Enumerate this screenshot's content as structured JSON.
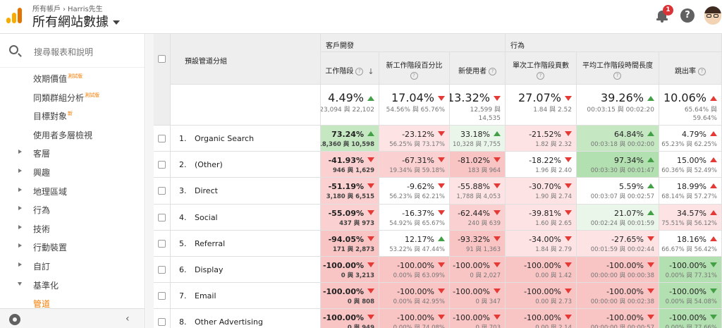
{
  "header": {
    "breadcrumb_account": "所有帳戶",
    "breadcrumb_property": "Harris先生",
    "view_title": "所有網站數據",
    "notification_count": "1",
    "help_icon": "?"
  },
  "sidebar": {
    "search_placeholder": "搜尋報表和說明",
    "items": [
      {
        "label": "效期價值",
        "tag": "測試版",
        "kind": "sub"
      },
      {
        "label": "同類群組分析",
        "tag": "測試版",
        "kind": "sub"
      },
      {
        "label": "目標對象",
        "tag": "新",
        "kind": "sub"
      },
      {
        "label": "使用者多層檢視",
        "tag": "",
        "kind": "sub"
      },
      {
        "label": "客層",
        "tag": "",
        "kind": "collapsed"
      },
      {
        "label": "興趣",
        "tag": "",
        "kind": "collapsed"
      },
      {
        "label": "地理區域",
        "tag": "",
        "kind": "collapsed"
      },
      {
        "label": "行為",
        "tag": "",
        "kind": "collapsed"
      },
      {
        "label": "技術",
        "tag": "",
        "kind": "collapsed"
      },
      {
        "label": "行動裝置",
        "tag": "",
        "kind": "collapsed"
      },
      {
        "label": "自訂",
        "tag": "",
        "kind": "collapsed"
      },
      {
        "label": "基準化",
        "tag": "",
        "kind": "expanded"
      },
      {
        "label": "管道",
        "tag": "",
        "kind": "active"
      }
    ],
    "collapse_glyph": "‹"
  },
  "table": {
    "dimension_header": "預設管道分組",
    "group_acquisition": "客戶開發",
    "group_behavior": "行為",
    "columns": [
      "工作階段",
      "新工作階段百分比",
      "新使用者",
      "單次工作階段頁數",
      "平均工作階段時間長度",
      "跳出率"
    ],
    "sort_glyph": "↓",
    "totals": [
      {
        "main": "4.49%",
        "dir": "up",
        "color": "g",
        "sub": [
          "23,094 與 22,102"
        ]
      },
      {
        "main": "17.04%",
        "dir": "dn",
        "color": "r",
        "sub": [
          "54.56% 與 65.76%"
        ]
      },
      {
        "main": "13.32%",
        "dir": "dn",
        "color": "r",
        "sub": [
          "12,599 與",
          "14,535"
        ]
      },
      {
        "main": "27.07%",
        "dir": "dn",
        "color": "r",
        "sub": [
          "1.84 與 2.52"
        ]
      },
      {
        "main": "39.26%",
        "dir": "up",
        "color": "g",
        "sub": [
          "00:03:15 與 00:02:20"
        ]
      },
      {
        "main": "10.06%",
        "dir": "up",
        "color": "r",
        "sub": [
          "65.64% 與",
          "59.64%"
        ]
      }
    ],
    "rows": [
      {
        "idx": "1.",
        "name": "Organic Search",
        "cells": [
          {
            "v": "73.24%",
            "d": "up",
            "c": "g",
            "s": "18,360 與 10,598",
            "bg": "#c5e8c3"
          },
          {
            "v": "-23.12%",
            "d": "dn",
            "c": "r",
            "s": "56.25% 與 73.17%",
            "bg": "#fde3e3"
          },
          {
            "v": "33.18%",
            "d": "up",
            "c": "g",
            "s": "10,328 與 7,755",
            "bg": "#eaf6e9"
          },
          {
            "v": "-21.52%",
            "d": "dn",
            "c": "r",
            "s": "1.82 與 2.32",
            "bg": "#fde3e3"
          },
          {
            "v": "64.84%",
            "d": "up",
            "c": "g",
            "s": "00:03:18 與 00:02:00",
            "bg": "#c5e8c3"
          },
          {
            "v": "4.79%",
            "d": "up",
            "c": "r",
            "s": "65.23% 與 62.25%",
            "bg": "#ffffff"
          }
        ]
      },
      {
        "idx": "2.",
        "name": "(Other)",
        "cells": [
          {
            "v": "-41.93%",
            "d": "dn",
            "c": "r",
            "s": "946 與 1,629",
            "bg": "#fbd0d0"
          },
          {
            "v": "-67.31%",
            "d": "dn",
            "c": "r",
            "s": "19.34% 與 59.18%",
            "bg": "#fbd0d0"
          },
          {
            "v": "-81.02%",
            "d": "dn",
            "c": "r",
            "s": "183 與 964",
            "bg": "#f9c4c4"
          },
          {
            "v": "-18.22%",
            "d": "dn",
            "c": "r",
            "s": "1.96 與 2.40",
            "bg": "#ffffff"
          },
          {
            "v": "97.34%",
            "d": "up",
            "c": "g",
            "s": "00:03:30 與 00:01:47",
            "bg": "#b3e0b0"
          },
          {
            "v": "15.00%",
            "d": "up",
            "c": "r",
            "s": "60.36% 與 52.49%",
            "bg": "#ffffff"
          }
        ]
      },
      {
        "idx": "3.",
        "name": "Direct",
        "cells": [
          {
            "v": "-51.19%",
            "d": "dn",
            "c": "r",
            "s": "3,180 與 6,515",
            "bg": "#fbd0d0"
          },
          {
            "v": "-9.62%",
            "d": "dn",
            "c": "r",
            "s": "56.23% 與 62.21%",
            "bg": "#ffffff"
          },
          {
            "v": "-55.88%",
            "d": "dn",
            "c": "r",
            "s": "1,788 與 4,053",
            "bg": "#fde3e3"
          },
          {
            "v": "-30.70%",
            "d": "dn",
            "c": "r",
            "s": "1.90 與 2.74",
            "bg": "#fde3e3"
          },
          {
            "v": "5.59%",
            "d": "up",
            "c": "g",
            "s": "00:03:07 與 00:02:57",
            "bg": "#ffffff"
          },
          {
            "v": "18.99%",
            "d": "up",
            "c": "r",
            "s": "68.14% 與 57.27%",
            "bg": "#ffffff"
          }
        ]
      },
      {
        "idx": "4.",
        "name": "Social",
        "cells": [
          {
            "v": "-55.09%",
            "d": "dn",
            "c": "r",
            "s": "437 與 973",
            "bg": "#fbd0d0"
          },
          {
            "v": "-16.37%",
            "d": "dn",
            "c": "r",
            "s": "54.92% 與 65.67%",
            "bg": "#ffffff"
          },
          {
            "v": "-62.44%",
            "d": "dn",
            "c": "r",
            "s": "240 與 639",
            "bg": "#fbd0d0"
          },
          {
            "v": "-39.81%",
            "d": "dn",
            "c": "r",
            "s": "1.60 與 2.65",
            "bg": "#fde3e3"
          },
          {
            "v": "21.07%",
            "d": "up",
            "c": "g",
            "s": "00:02:24 與 00:01:59",
            "bg": "#eaf6e9"
          },
          {
            "v": "34.57%",
            "d": "up",
            "c": "r",
            "s": "75.51% 與 56.12%",
            "bg": "#fde3e3"
          }
        ]
      },
      {
        "idx": "5.",
        "name": "Referral",
        "cells": [
          {
            "v": "-94.05%",
            "d": "dn",
            "c": "r",
            "s": "171 與 2,873",
            "bg": "#f9c4c4"
          },
          {
            "v": "12.17%",
            "d": "up",
            "c": "g",
            "s": "53.22% 與 47.44%",
            "bg": "#ffffff"
          },
          {
            "v": "-93.32%",
            "d": "dn",
            "c": "r",
            "s": "91 與 1,363",
            "bg": "#f9c4c4"
          },
          {
            "v": "-34.00%",
            "d": "dn",
            "c": "r",
            "s": "1.84 與 2.79",
            "bg": "#fde3e3"
          },
          {
            "v": "-27.65%",
            "d": "dn",
            "c": "r",
            "s": "00:01:59 與 00:02:44",
            "bg": "#fde3e3"
          },
          {
            "v": "18.16%",
            "d": "up",
            "c": "r",
            "s": "66.67% 與 56.42%",
            "bg": "#ffffff"
          }
        ]
      },
      {
        "idx": "6.",
        "name": "Display",
        "cells": [
          {
            "v": "-100.00%",
            "d": "dn",
            "c": "r",
            "s": "0 與 3,213",
            "bg": "#f9c4c4"
          },
          {
            "v": "-100.00%",
            "d": "dn",
            "c": "r",
            "s": "0.00% 與 63.09%",
            "bg": "#f9c4c4"
          },
          {
            "v": "-100.00%",
            "d": "dn",
            "c": "r",
            "s": "0 與 2,027",
            "bg": "#f9c4c4"
          },
          {
            "v": "-100.00%",
            "d": "dn",
            "c": "r",
            "s": "0.00 與 1.42",
            "bg": "#f9c4c4"
          },
          {
            "v": "-100.00%",
            "d": "dn",
            "c": "r",
            "s": "00:00:00 與 00:00:38",
            "bg": "#f9c4c4"
          },
          {
            "v": "-100.00%",
            "d": "dn",
            "c": "g",
            "s": "0.00% 與 77.31%",
            "bg": "#b3e0b0"
          }
        ]
      },
      {
        "idx": "7.",
        "name": "Email",
        "cells": [
          {
            "v": "-100.00%",
            "d": "dn",
            "c": "r",
            "s": "0 與 808",
            "bg": "#f9c4c4"
          },
          {
            "v": "-100.00%",
            "d": "dn",
            "c": "r",
            "s": "0.00% 與 42.95%",
            "bg": "#f9c4c4"
          },
          {
            "v": "-100.00%",
            "d": "dn",
            "c": "r",
            "s": "0 與 347",
            "bg": "#f9c4c4"
          },
          {
            "v": "-100.00%",
            "d": "dn",
            "c": "r",
            "s": "0.00 與 2.73",
            "bg": "#f9c4c4"
          },
          {
            "v": "-100.00%",
            "d": "dn",
            "c": "r",
            "s": "00:00:00 與 00:02:38",
            "bg": "#f9c4c4"
          },
          {
            "v": "-100.00%",
            "d": "dn",
            "c": "g",
            "s": "0.00% 與 54.08%",
            "bg": "#b3e0b0"
          }
        ]
      },
      {
        "idx": "8.",
        "name": "Other Advertising",
        "cells": [
          {
            "v": "-100.00%",
            "d": "dn",
            "c": "r",
            "s": "0 與 949",
            "bg": "#f9c4c4"
          },
          {
            "v": "-100.00%",
            "d": "dn",
            "c": "r",
            "s": "0.00% 與 74.08%",
            "bg": "#f9c4c4"
          },
          {
            "v": "-100.00%",
            "d": "dn",
            "c": "r",
            "s": "0 與 703",
            "bg": "#f9c4c4"
          },
          {
            "v": "-100.00%",
            "d": "dn",
            "c": "r",
            "s": "0.00 與 2.14",
            "bg": "#f9c4c4"
          },
          {
            "v": "-100.00%",
            "d": "dn",
            "c": "r",
            "s": "00:00:00 與 00:00:57",
            "bg": "#f9c4c4"
          },
          {
            "v": "-100.00%",
            "d": "dn",
            "c": "g",
            "s": "0.00% 與 77.66%",
            "bg": "#b3e0b0"
          }
        ]
      }
    ]
  }
}
